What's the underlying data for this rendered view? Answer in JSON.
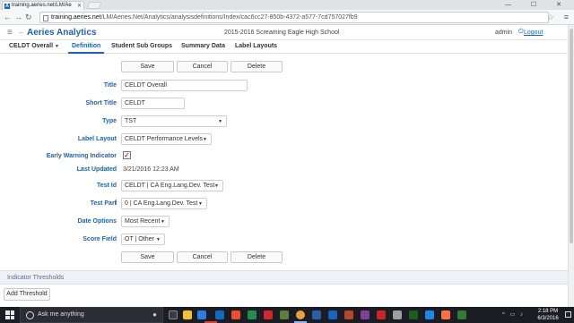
{
  "browser": {
    "tab_title": "training.aeries.net/LM/Ae",
    "tab_favicon": "A",
    "url_host": "training.aeries.net",
    "url_path": "/LM/Aeries.Net/Analytics/analysisdefinitions/Index/cac6cc27-850b-4372-a577-7cd757027fb9",
    "window_controls": "— ☐ ✕"
  },
  "header": {
    "brand": "Aeries Analytics",
    "school": "2015-2016 Screaming Eagle High School",
    "user": "admin",
    "logout": "Logout"
  },
  "subnav": {
    "definition_select": "CELDT Overall",
    "tabs": [
      "Definition",
      "Student Sub Groups",
      "Summary Data",
      "Label Layouts"
    ],
    "active_tab": "Definition"
  },
  "form": {
    "save": "Save",
    "cancel": "Cancel",
    "delete": "Delete",
    "title_label": "Title",
    "title_value": "CELDT Overall",
    "short_title_label": "Short Title",
    "short_title_value": "CELDT",
    "type_label": "Type",
    "type_value": "TST",
    "label_layout_label": "Label Layout",
    "label_layout_value": "CELDT Performance Levels",
    "early_warning_label": "Early Warning Indicator",
    "early_warning_checked": "✓",
    "last_updated_label": "Last Updated",
    "last_updated_value": "3/21/2016 12:23 AM",
    "test_id_label": "Test Id",
    "test_id_value": "CELDT | CA Eng.Lang.Dev. Test",
    "test_part_label": "Test Part",
    "test_part_value": "0 | CA Eng.Lang.Dev. Test",
    "date_options_label": "Date Options",
    "date_options_value": "Most Recent",
    "score_field_label": "Score Field",
    "score_field_value": "OT | Other"
  },
  "sections": {
    "indicator_thresholds": "Indicator Thresholds",
    "add_threshold": "Add Threshold"
  },
  "taskbar": {
    "search_placeholder": "Ask me anything",
    "time": "2:18 PM",
    "date": "6/3/2016"
  },
  "colors": {
    "accent": "#2262a8",
    "taskbar": "#1c1c24"
  }
}
